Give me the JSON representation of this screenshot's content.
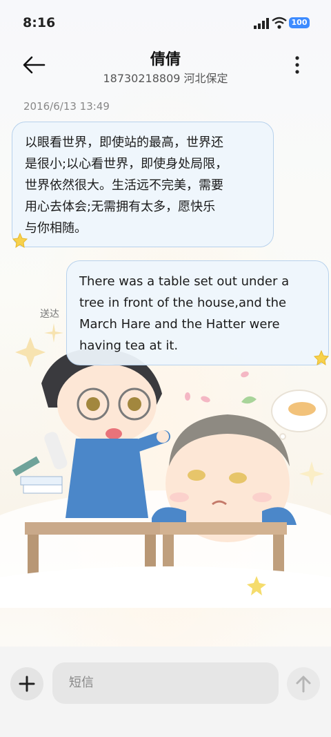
{
  "status_bar": {
    "time": "8:16",
    "battery": "100"
  },
  "header": {
    "contact_name": "倩倩",
    "contact_info": "18730218809 河北保定"
  },
  "messages": [
    {
      "direction": "incoming",
      "timestamp": "2016/6/13 13:49",
      "lines": [
        "以眼看世界，即使站的最高，世界还",
        "是很小;以心看世界，即使身处局限，",
        "世界依然很大。生活远不完美，需要",
        "用心去体会;无需拥有太多，愿快乐",
        "与你相随。"
      ]
    },
    {
      "direction": "outgoing",
      "status": "送达",
      "lines": [
        "There was a table set out under a",
        "tree in front of the house,and the",
        "March Hare and the Hatter were",
        "having tea at it."
      ]
    }
  ],
  "composer": {
    "placeholder": "短信"
  },
  "colors": {
    "bubble_border": "#b7d1ec",
    "bubble_fill": "#eef5fc",
    "battery": "#3d8bff"
  },
  "icons": {
    "back": "arrow-left-icon",
    "more": "more-vertical-icon",
    "add": "plus-icon",
    "send": "arrow-up-icon"
  }
}
